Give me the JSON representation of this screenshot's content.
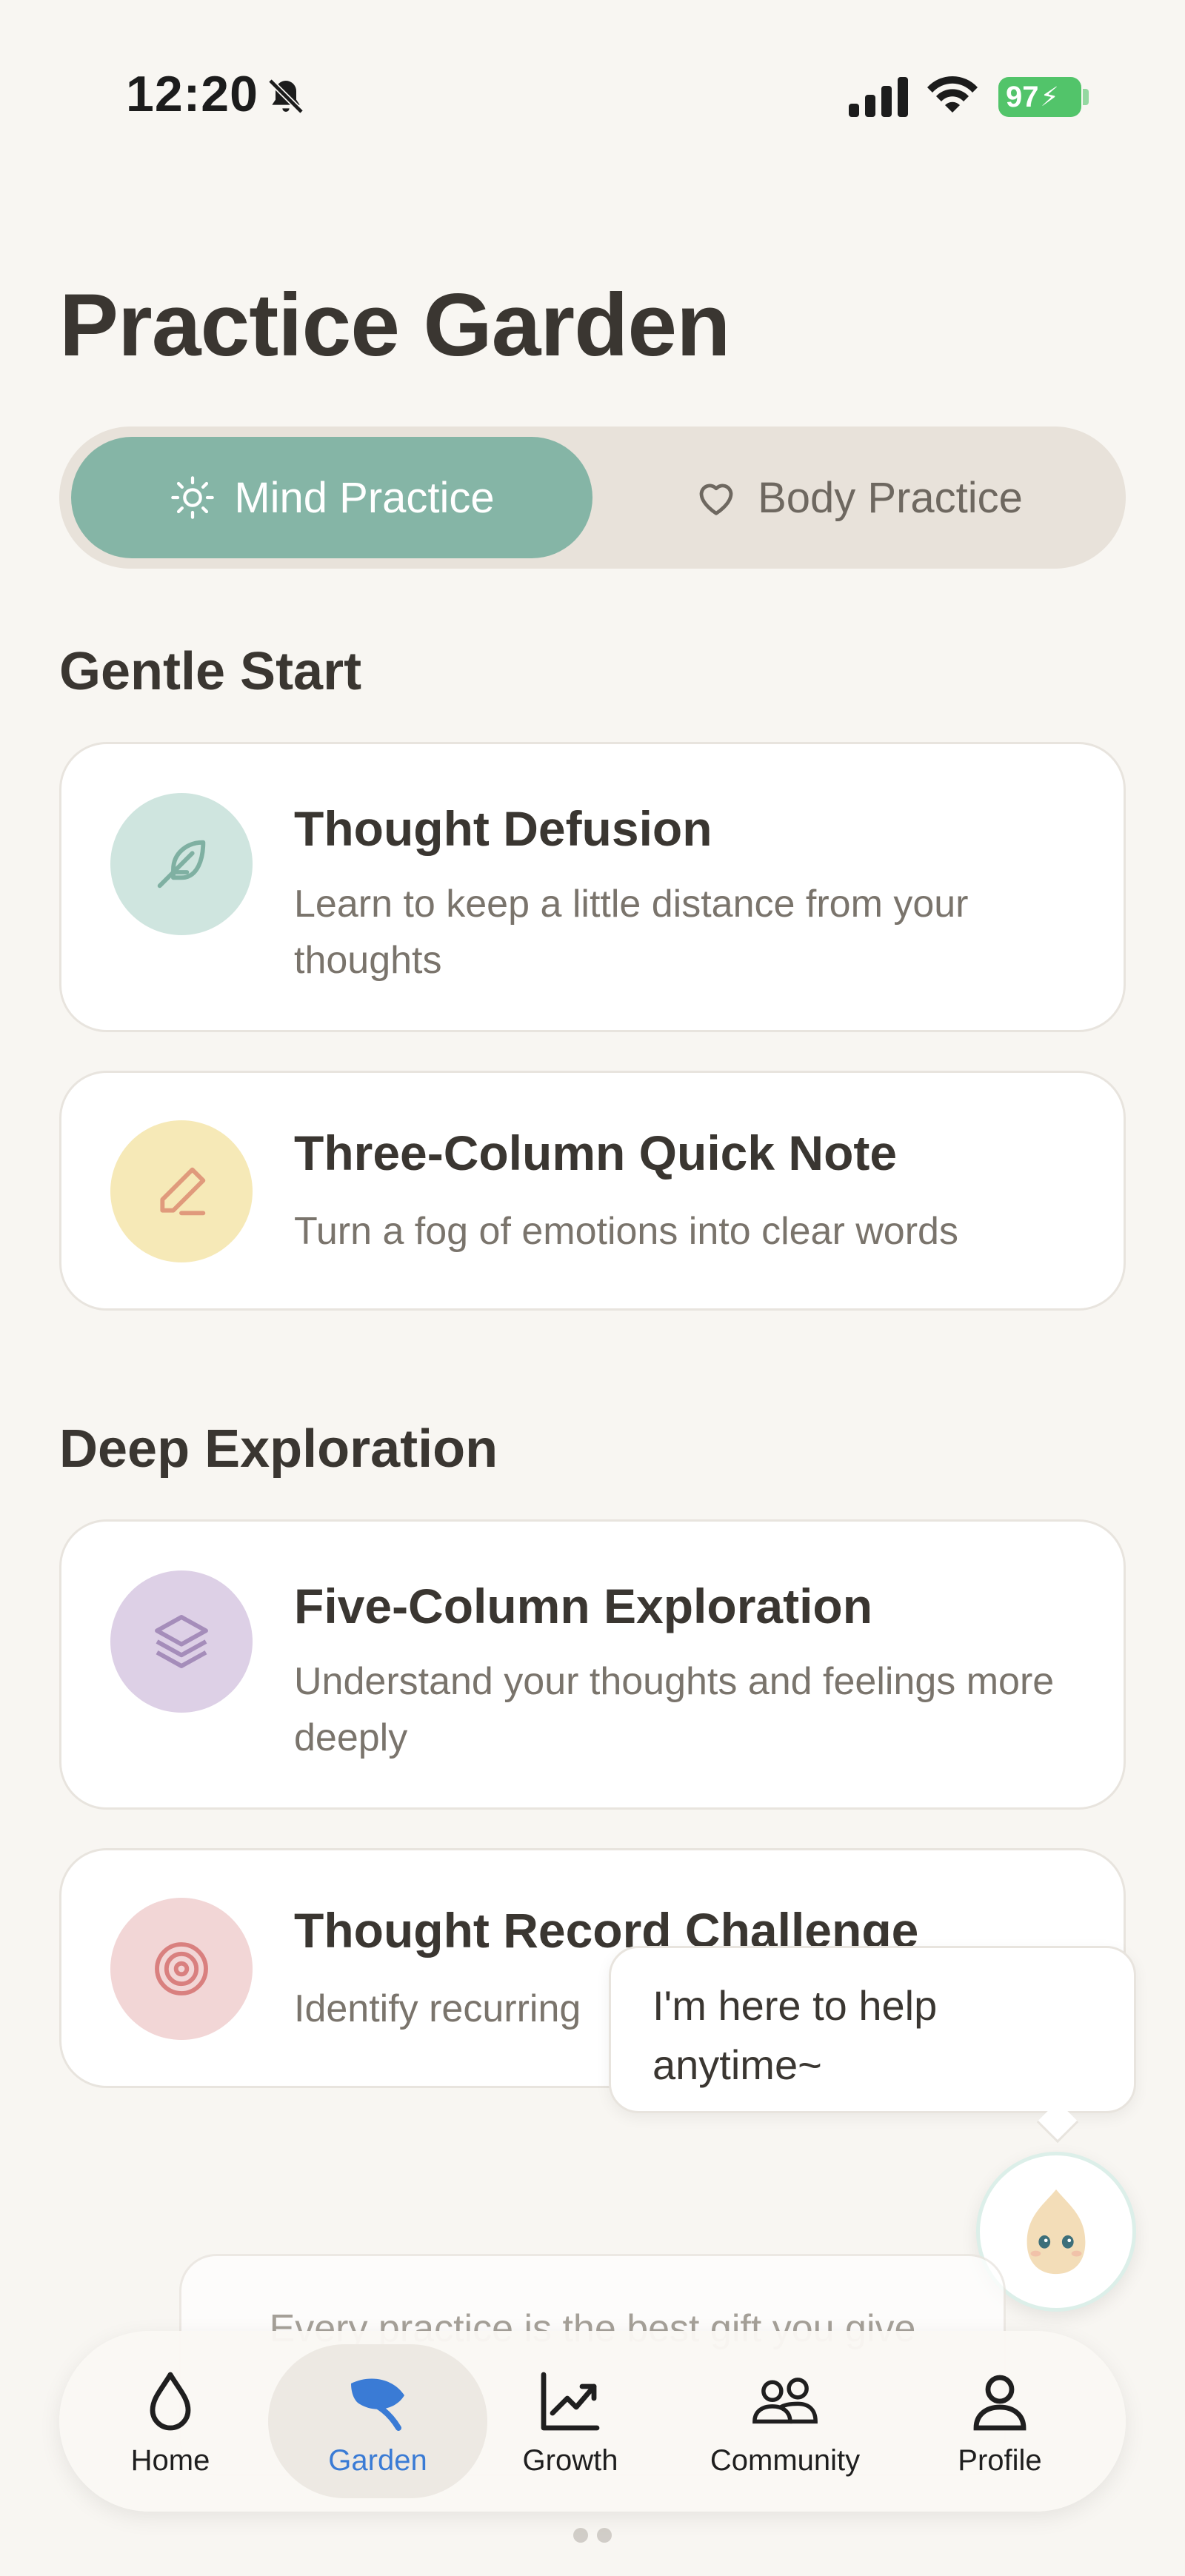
{
  "status_bar": {
    "time": "12:20",
    "battery": "97"
  },
  "page_title": "Practice Garden",
  "tabs": [
    {
      "label": "Mind Practice",
      "icon": "sun-icon",
      "selected": true
    },
    {
      "label": "Body Practice",
      "icon": "heart-icon",
      "selected": false
    }
  ],
  "sections": [
    {
      "title": "Gentle Start",
      "cards": [
        {
          "title": "Thought Defusion",
          "desc": "Learn to keep a little distance from your thoughts",
          "icon": "feather-icon",
          "color": "#cfe5df"
        },
        {
          "title": "Three-Column Quick Note",
          "desc": "Turn a fog of emotions into clear words",
          "icon": "pencil-icon",
          "color": "#f6e9b7"
        }
      ]
    },
    {
      "title": "Deep Exploration",
      "cards": [
        {
          "title": "Five-Column Exploration",
          "desc": "Understand your thoughts and feelings more deeply",
          "icon": "layers-icon",
          "color": "#ddd0e6"
        },
        {
          "title": "Thought Record Challenge",
          "desc": "Identify recurring",
          "icon": "target-icon",
          "color": "#f2d6d6"
        }
      ]
    }
  ],
  "bubble": {
    "text": "I'm here to help anytime~"
  },
  "quote": {
    "text": "Every practice is the best gift you give"
  },
  "nav": [
    {
      "label": "Home",
      "icon": "drop-icon"
    },
    {
      "label": "Garden",
      "icon": "leaf-icon",
      "active": true
    },
    {
      "label": "Growth",
      "icon": "chart-icon"
    },
    {
      "label": "Community",
      "icon": "people-icon"
    },
    {
      "label": "Profile",
      "icon": "person-icon"
    }
  ],
  "colors": {
    "accent": "#85b5a6",
    "nav_active": "#3a7bd5",
    "battery": "#52c46a"
  }
}
